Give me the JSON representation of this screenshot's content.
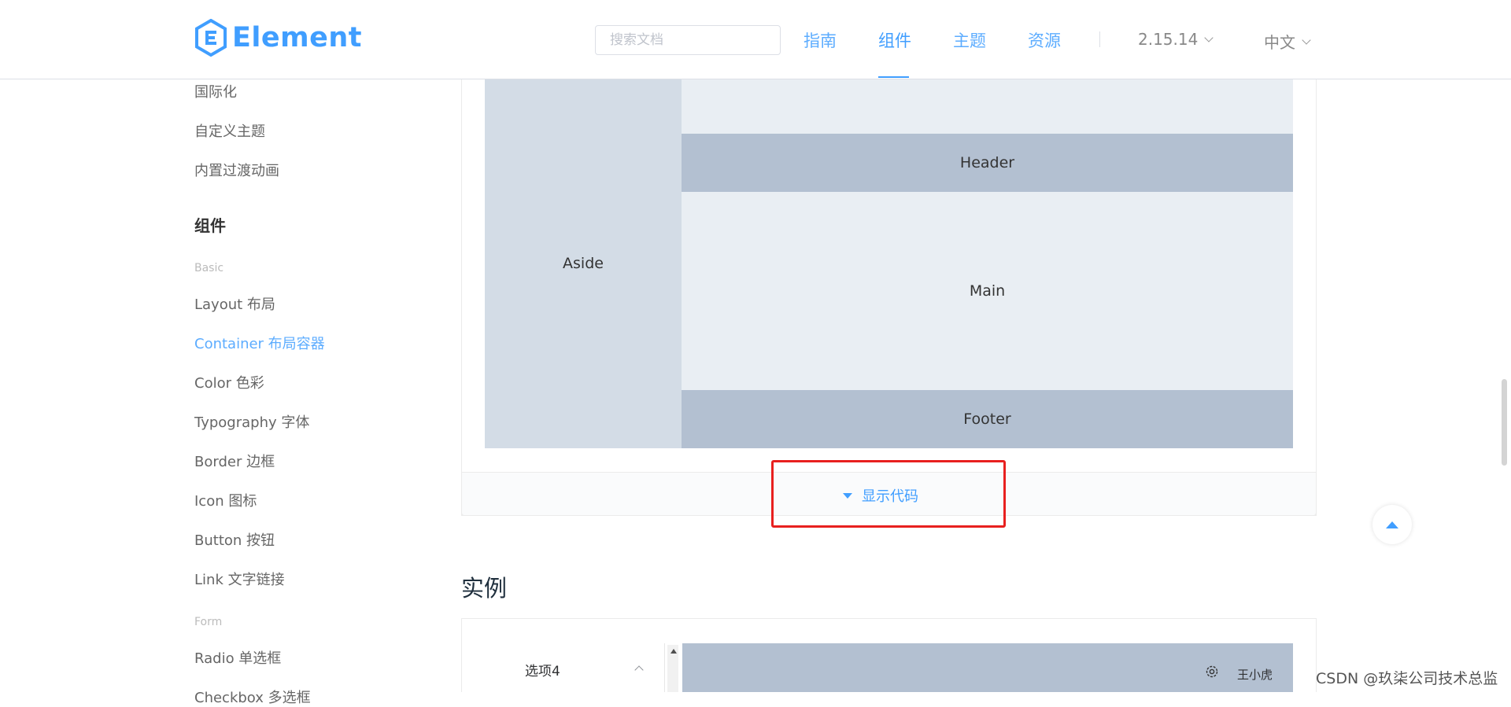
{
  "header": {
    "logo_text": "Element",
    "search_placeholder": "搜索文档",
    "nav": [
      {
        "label": "指南"
      },
      {
        "label": "组件"
      },
      {
        "label": "主题"
      },
      {
        "label": "资源"
      }
    ],
    "version": "2.15.14",
    "language": "中文",
    "accent_color": "#409eff"
  },
  "sidebar": {
    "top_items": [
      "国际化",
      "自定义主题",
      "内置过渡动画"
    ],
    "section": "组件",
    "group_basic": "Basic",
    "basic_items": [
      "Layout 布局",
      "Container 布局容器",
      "Color 色彩",
      "Typography 字体",
      "Border 边框",
      "Icon 图标",
      "Button 按钮",
      "Link 文字链接"
    ],
    "active_item": "Container 布局容器",
    "group_form": "Form",
    "form_items": [
      "Radio 单选框",
      "Checkbox 多选框"
    ]
  },
  "demo": {
    "aside": "Aside",
    "header": "Header",
    "main": "Main",
    "footer": "Footer",
    "show_code": "显示代码"
  },
  "section_title": "实例",
  "demo2": {
    "menu_title": "选项4",
    "user": "王小虎"
  },
  "watermark": "CSDN @玖柒公司技术总监"
}
